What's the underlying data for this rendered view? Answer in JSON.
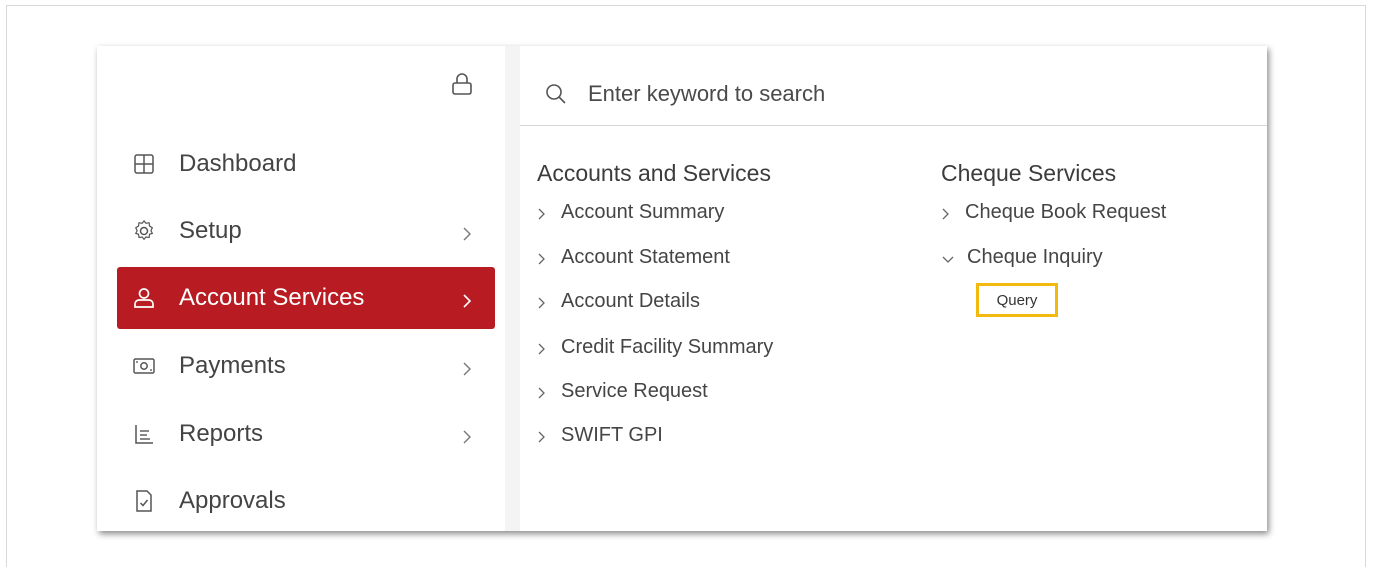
{
  "search": {
    "placeholder": "Enter keyword to search"
  },
  "sidebar": {
    "items": [
      {
        "label": "Dashboard"
      },
      {
        "label": "Setup"
      },
      {
        "label": "Account Services"
      },
      {
        "label": "Payments"
      },
      {
        "label": "Reports"
      },
      {
        "label": "Approvals"
      }
    ]
  },
  "menu": {
    "col1": {
      "title": "Accounts and Services",
      "links": [
        "Account Summary",
        "Account Statement",
        "Account Details",
        "Credit Facility Summary",
        "Service Request",
        "SWIFT GPI"
      ]
    },
    "col2": {
      "title": "Cheque Services",
      "links": [
        "Cheque Book Request",
        "Cheque Inquiry"
      ],
      "sub_item": "Query"
    }
  },
  "colors": {
    "accent": "#b81c22",
    "highlight": "#f2b90f"
  },
  "icons": [
    "lock-icon",
    "dashboard-icon",
    "setup-gear-icon",
    "account-user-icon",
    "payments-cash-icon",
    "reports-icon",
    "approvals-doc-icon",
    "search-icon",
    "chevron-right-icon",
    "chevron-down-icon"
  ]
}
